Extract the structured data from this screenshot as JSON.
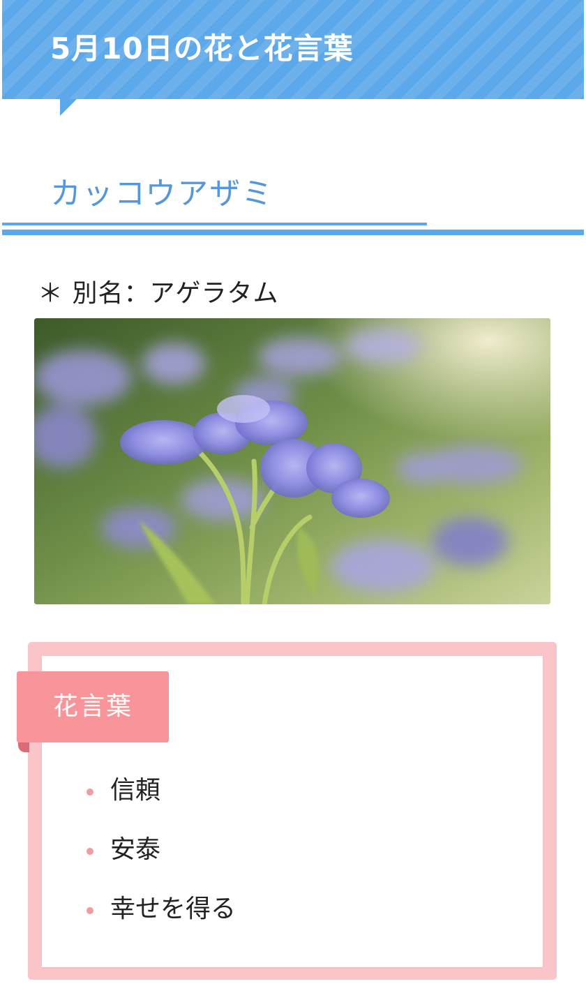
{
  "header": {
    "title": "5月10日の花と花言葉"
  },
  "flower": {
    "name": "カッコウアザミ",
    "alias_line": "＊ 別名：アゲラタム"
  },
  "photo": {
    "subject": "purple ageratum flowers"
  },
  "hanakotoba": {
    "label": "花言葉",
    "items": [
      "信頼",
      "安泰",
      "幸せを得る"
    ]
  },
  "colors": {
    "header_blue": "#5ba8ea",
    "heading_text_blue": "#5596dc",
    "card_pink": "#fac5c8",
    "ribbon_pink": "#f7959a",
    "bullet_pink": "#f29ba0"
  }
}
